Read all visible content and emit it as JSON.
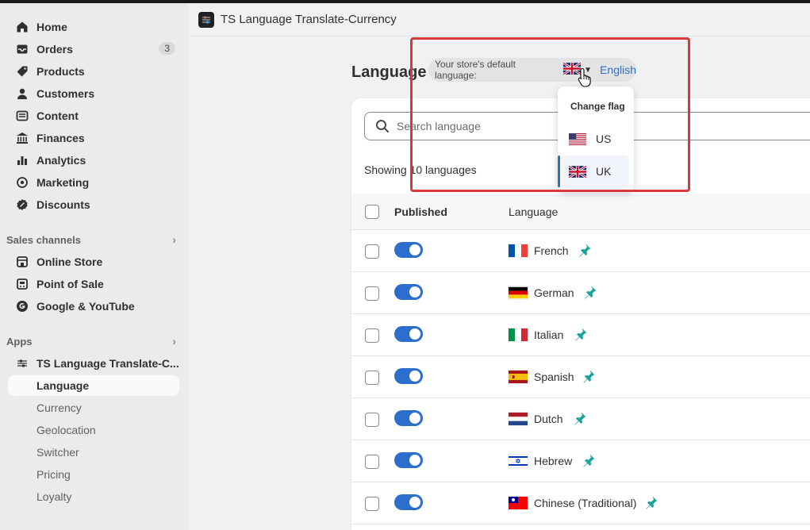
{
  "sidebar": {
    "items": [
      {
        "label": "Home",
        "icon": "home-icon"
      },
      {
        "label": "Orders",
        "icon": "inbox-icon",
        "badge": "3"
      },
      {
        "label": "Products",
        "icon": "tag-icon"
      },
      {
        "label": "Customers",
        "icon": "person-icon"
      },
      {
        "label": "Content",
        "icon": "content-icon"
      },
      {
        "label": "Finances",
        "icon": "bank-icon"
      },
      {
        "label": "Analytics",
        "icon": "bar-chart-icon"
      },
      {
        "label": "Marketing",
        "icon": "target-icon"
      },
      {
        "label": "Discounts",
        "icon": "discount-icon"
      }
    ],
    "sales_channels_label": "Sales channels",
    "channels": [
      {
        "label": "Online Store",
        "icon": "store-icon"
      },
      {
        "label": "Point of Sale",
        "icon": "pos-icon"
      },
      {
        "label": "Google & YouTube",
        "icon": "google-icon"
      }
    ],
    "apps_label": "Apps",
    "app_name": "TS Language Translate-C...",
    "app_subitems": [
      "Language",
      "Currency",
      "Geolocation",
      "Switcher",
      "Pricing",
      "Loyalty"
    ],
    "active_subitem": "Language"
  },
  "header": {
    "app_title": "TS Language Translate-Currency"
  },
  "page": {
    "title": "Language",
    "default_language_label": "Your store's default language:",
    "default_language": "English",
    "search_placeholder": "Search language",
    "showing_text": "Showing 10 languages",
    "table": {
      "col_published": "Published",
      "col_language": "Language",
      "rows": [
        {
          "name": "French",
          "flag": "fr",
          "published": true
        },
        {
          "name": "German",
          "flag": "de",
          "published": true
        },
        {
          "name": "Italian",
          "flag": "it",
          "published": true
        },
        {
          "name": "Spanish",
          "flag": "es",
          "published": true
        },
        {
          "name": "Dutch",
          "flag": "nl",
          "published": true
        },
        {
          "name": "Hebrew",
          "flag": "il",
          "published": true
        },
        {
          "name": "Chinese (Traditional)",
          "flag": "tw",
          "published": true
        }
      ]
    }
  },
  "flag_menu": {
    "title": "Change flag",
    "options": [
      "US",
      "UK"
    ],
    "selected": "UK"
  },
  "colors": {
    "accent": "#2c6ecb",
    "pin": "#1aa39b",
    "highlight": "#d9383f"
  }
}
